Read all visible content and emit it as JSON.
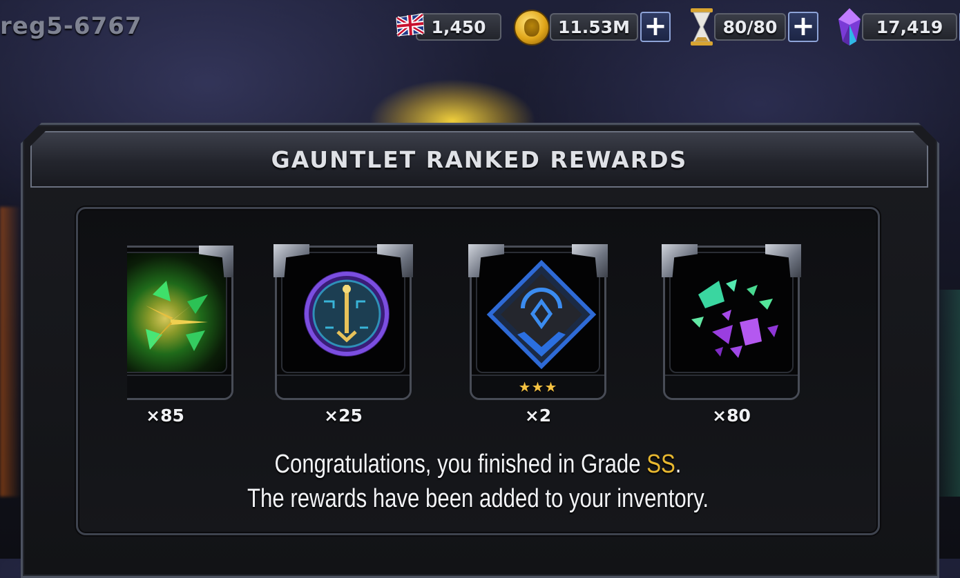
{
  "player": {
    "name": "reg5-6767"
  },
  "currencies": [
    {
      "id": "battlechips",
      "icon": "uk-flag-icon",
      "value": "1,450",
      "has_plus": false
    },
    {
      "id": "gold",
      "icon": "gold-coin-icon",
      "value": "11.53M",
      "has_plus": true
    },
    {
      "id": "energy",
      "icon": "hourglass-icon",
      "value": "80/80",
      "has_plus": true
    },
    {
      "id": "crystals",
      "icon": "crystal-icon",
      "value": "17,419",
      "has_plus": true
    }
  ],
  "dialog": {
    "title": "GAUNTLET RANKED REWARDS",
    "rewards": [
      {
        "icon": "green-crystal-shards-icon",
        "quantity": "×85",
        "stars": ""
      },
      {
        "icon": "gauntlet-key-token-icon",
        "quantity": "×25",
        "stars": ""
      },
      {
        "icon": "blue-rank-up-material-icon",
        "quantity": "×2",
        "stars": "★★★"
      },
      {
        "icon": "green-purple-crystal-shards-icon",
        "quantity": "×80",
        "stars": ""
      }
    ],
    "message": {
      "line1_prefix": "Congratulations, you finished in Grade ",
      "grade": "SS",
      "line1_suffix": ".",
      "line2": "The rewards have been added to your inventory."
    }
  },
  "colors": {
    "grade_gold": "#e8b830",
    "plus_border": "#8ea4d8",
    "star_gold": "#f5c242"
  }
}
